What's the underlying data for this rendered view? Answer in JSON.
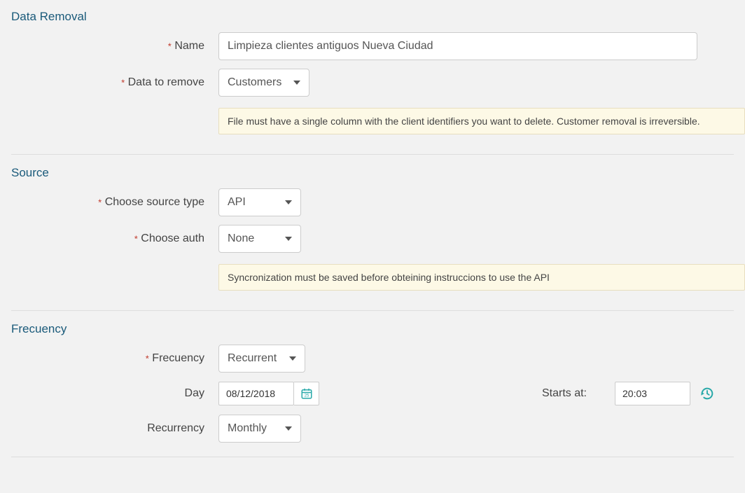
{
  "sections": {
    "data_removal": {
      "title": "Data Removal",
      "name_label": "Name",
      "name_value": "Limpieza clientes antiguos Nueva Ciudad",
      "data_to_remove_label": "Data to remove",
      "data_to_remove_value": "Customers",
      "notice": "File must have a single column with the client identifiers you want to delete. Customer removal is irreversible."
    },
    "source": {
      "title": "Source",
      "source_type_label": "Choose source type",
      "source_type_value": "API",
      "auth_label": "Choose auth",
      "auth_value": "None",
      "notice": "Syncronization must be saved before obteining instruccions to use the API"
    },
    "frequency": {
      "title": "Frecuency",
      "frequency_label": "Frecuency",
      "frequency_value": "Recurrent",
      "day_label": "Day",
      "day_value": "08/12/2018",
      "starts_at_label": "Starts at:",
      "starts_at_value": "20:03",
      "recurrency_label": "Recurrency",
      "recurrency_value": "Monthly"
    }
  },
  "colors": {
    "section_title": "#1a5a7a",
    "required": "#c0392b",
    "notice_bg": "#fdf9e6",
    "icon_teal": "#2aa9a9"
  }
}
